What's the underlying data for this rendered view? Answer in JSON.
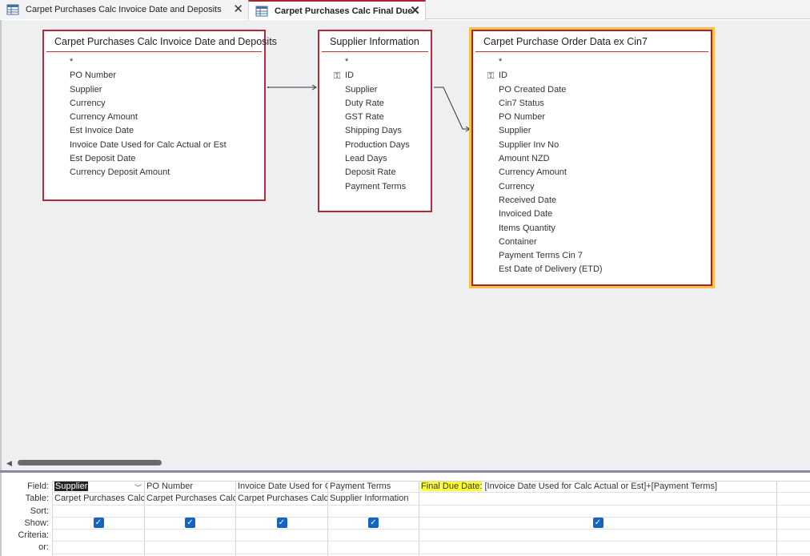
{
  "tabs": [
    {
      "label": "Carpet Purchases Calc Invoice Date and Deposits",
      "close": "✕",
      "active": false
    },
    {
      "label": "Carpet Purchases Calc Final Due",
      "close": "✕",
      "active": true
    }
  ],
  "tables": {
    "t1": {
      "title": "Carpet Purchases Calc Invoice Date and Deposits",
      "fields": [
        "*",
        "PO Number",
        "Supplier",
        "Currency",
        "Currency Amount",
        "Est Invoice Date",
        "Invoice Date Used for Calc Actual or Est",
        "Est Deposit Date",
        "Currency Deposit Amount"
      ]
    },
    "t2": {
      "title": "Supplier Information",
      "fields": [
        "*",
        "ID",
        "Supplier",
        "Duty Rate",
        "GST Rate",
        "Shipping Days",
        "Production Days",
        "Lead Days",
        "Deposit Rate",
        "Payment Terms"
      ]
    },
    "t3": {
      "title": "Carpet Purchase Order Data ex Cin7",
      "fields": [
        "*",
        "ID",
        "PO Created Date",
        "Cin7 Status",
        "PO Number",
        "Supplier",
        "Supplier Inv No",
        "Amount NZD",
        "Currency Amount",
        "Currency",
        "Received Date",
        "Invoiced Date",
        "Items Quantity",
        "Container",
        "Payment Terms Cin 7",
        "Est Date of Delivery (ETD)"
      ]
    }
  },
  "grid": {
    "row_labels": [
      "Field:",
      "Table:",
      "Sort:",
      "Show:",
      "Criteria:",
      "or:"
    ],
    "columns": [
      {
        "field": "Supplier",
        "table": "Carpet Purchases Calc Invoice Date and Deposits",
        "show": true
      },
      {
        "field": "PO Number",
        "table": "Carpet Purchases Calc Invoice Date and Deposits",
        "show": true
      },
      {
        "field": "Invoice Date Used for Calc Actual or Est",
        "table": "Carpet Purchases Calc Invoice Date and Deposits",
        "show": true
      },
      {
        "field": "Payment Terms",
        "table": "Supplier Information",
        "show": true
      },
      {
        "field_alias": "Final Due Date:",
        "field_expr": " [Invoice Date Used for Calc Actual or Est]+[Payment Terms]",
        "table": "",
        "show": true
      }
    ]
  },
  "icons": {
    "key": "key-icon",
    "check": "✓",
    "dropdown": "﹀",
    "scroll_left": "◀"
  },
  "colors": {
    "table_border": "#b52a3a",
    "selected_glow": "#f6c04a",
    "highlight": "#ffff2e",
    "checkbox": "#1565c0"
  }
}
